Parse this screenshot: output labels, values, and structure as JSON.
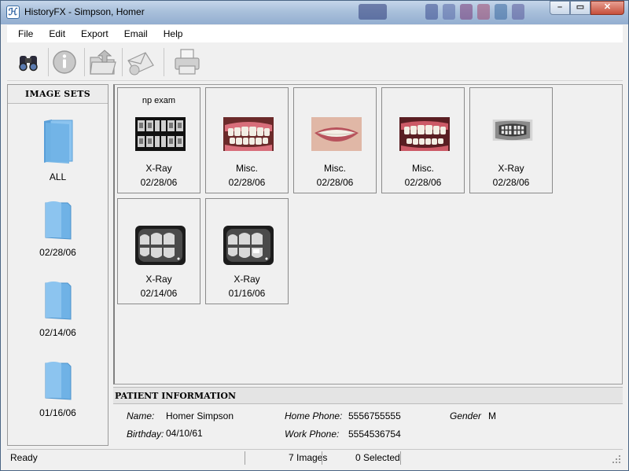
{
  "window": {
    "title": "HistoryFX - Simpson, Homer",
    "app_icon_glyph": "ℋ"
  },
  "menu": [
    "File",
    "Edit",
    "Export",
    "Email",
    "Help"
  ],
  "toolbar": [
    {
      "icon": "binoculars-icon"
    },
    {
      "icon": "info-icon"
    },
    {
      "icon": "export-folder-icon"
    },
    {
      "icon": "email-icon"
    },
    {
      "icon": "printer-icon"
    }
  ],
  "image_sets": {
    "header": "IMAGE SETS",
    "items": [
      "ALL",
      "02/28/06",
      "02/14/06",
      "01/16/06"
    ]
  },
  "images": [
    {
      "caption": "np exam",
      "type": "X-Ray",
      "date": "02/28/06",
      "kind": "xray-full"
    },
    {
      "caption": "",
      "type": "Misc.",
      "date": "02/28/06",
      "kind": "photo-teeth"
    },
    {
      "caption": "",
      "type": "Misc.",
      "date": "02/28/06",
      "kind": "photo-smile"
    },
    {
      "caption": "",
      "type": "Misc.",
      "date": "02/28/06",
      "kind": "photo-teeth"
    },
    {
      "caption": "",
      "type": "X-Ray",
      "date": "02/28/06",
      "kind": "xray-pano"
    },
    {
      "caption": "",
      "type": "X-Ray",
      "date": "02/14/06",
      "kind": "xray-bitewing"
    },
    {
      "caption": "",
      "type": "X-Ray",
      "date": "01/16/06",
      "kind": "xray-bitewing"
    }
  ],
  "patient": {
    "header": "PATIENT INFORMATION",
    "name_label": "Name:",
    "name": "Homer Simpson",
    "birthday_label": "Birthday:",
    "birthday": "04/10/61",
    "home_phone_label": "Home Phone:",
    "home_phone": "5556755555",
    "work_phone_label": "Work Phone:",
    "work_phone": "5554536754",
    "gender_label": "Gender",
    "gender": "M"
  },
  "status": {
    "state": "Ready",
    "image_count": "7 Images",
    "selected": "0 Selected"
  }
}
